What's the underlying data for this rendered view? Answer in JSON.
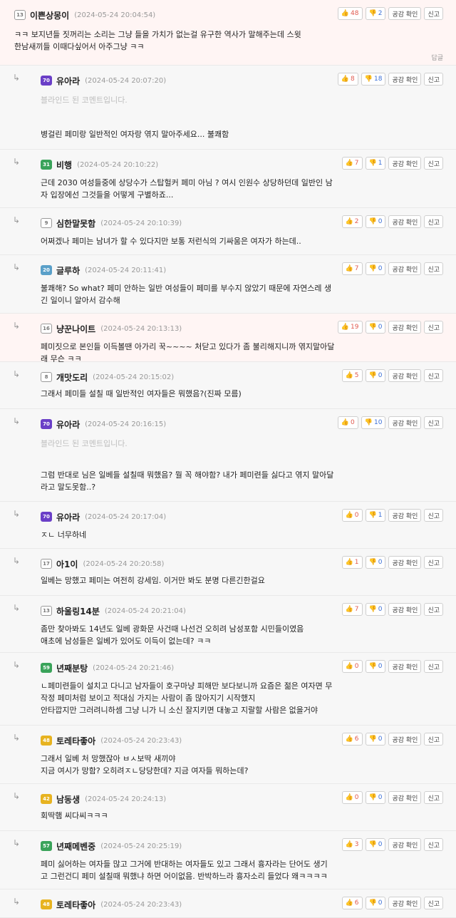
{
  "labels": {
    "empathy": "공감 확인",
    "report": "신고",
    "reply": "답글",
    "blind": "블라인드 된 코멘트입니다."
  },
  "colors": {
    "up": "#e05a4f",
    "down": "#3b6fd6",
    "highlight_bg": "#fff5f4",
    "reply_bg": "#f7f7f7"
  },
  "comments": [
    {
      "level": "13",
      "level_style": "grey",
      "name": "이쁜상몽이",
      "date": "(2024-05-24 20:04:54)",
      "up": "48",
      "down": "2",
      "text": "ㅋㅋ 보지년들 짓꺼리는 소리는 그냥 들을 가치가 없는걸 유구한 역사가 말해주는데 스윗\n한남새끼들 이때다싶어서 아주그냥 ㅋㅋ"
    },
    {
      "level": "70",
      "level_style": "purple",
      "name": "유아라",
      "date": "(2024-05-24 20:07:20)",
      "up": "8",
      "down": "18",
      "text": "병걸린 페미랑 일반적인 여자랑 엮지 말아주세요... 불쾌함"
    },
    {
      "level": "31",
      "level_style": "green",
      "name": "비행",
      "date": "(2024-05-24 20:10:22)",
      "up": "7",
      "down": "1",
      "text": "근데 2030 여성들중에 상당수가 스탑헐커 페미 아님 ? 여시 인원수 상당하던데 일반인 남\n자 입장에선 그것들을 어떻게 구별하죠..."
    },
    {
      "level": "9",
      "level_style": "grey",
      "name": "심한말못함",
      "date": "(2024-05-24 20:10:39)",
      "up": "2",
      "down": "0",
      "text": "어쩌겠나 페미는 남녀가 할 수 있다지만 보통 저런식의 기싸움은 여자가 하는데.."
    },
    {
      "level": "20",
      "level_style": "blue",
      "name": "글루하",
      "date": "(2024-05-24 20:11:41)",
      "up": "7",
      "down": "0",
      "text": "불쾌해? So what? 페미 안하는 일반 여성들이 페미를 부수지 않았기 때문에 자연스레 생\n긴 일이니 알아서 감수해"
    },
    {
      "level": "16",
      "level_style": "grey",
      "name": "냥꾼나이트",
      "date": "(2024-05-24 20:13:13)",
      "up": "19",
      "down": "0",
      "text": "페미짓으로 본인들 이득볼땐 아가리 꾹~~~~ 처닫고 있다가 좀 불리해지니까 엮지말아달\n래 무슨 ㅋㅋ"
    },
    {
      "level": "8",
      "level_style": "grey",
      "name": "개맛도리",
      "date": "(2024-05-24 20:15:02)",
      "up": "5",
      "down": "0",
      "text": "그래서 페미들 설칠 때 일반적인 여자들은 뭐했음?(진짜 모름)"
    },
    {
      "level": "70",
      "level_style": "purple",
      "name": "유아라",
      "date": "(2024-05-24 20:16:15)",
      "up": "0",
      "down": "10",
      "text": "그럼 반대로 님은 일베들 설칠때 뭐했음? 뭘 꼭 해야함? 내가 페미련들 싫다고 엮지 말아달\n라고 말도못함..?"
    },
    {
      "level": "70",
      "level_style": "purple",
      "name": "유아라",
      "date": "(2024-05-24 20:17:04)",
      "up": "0",
      "down": "1",
      "text": "ㅈㄴ 너무하네"
    },
    {
      "level": "17",
      "level_style": "grey",
      "name": "아1이",
      "date": "(2024-05-24 20:20:58)",
      "up": "1",
      "down": "0",
      "text": "일베는 망했고 페미는 여전히 강세임. 이거만 봐도 분명 다른긴한걸요"
    },
    {
      "level": "13",
      "level_style": "grey",
      "name": "하울링14분",
      "date": "(2024-05-24 20:21:04)",
      "up": "7",
      "down": "0",
      "text": "좀만 찾아봐도 14년도 일베 광화문 사건때 나선건 오히려 남성포함 시민들이였음\n애초에 남성들은 일베가 있어도 이득이 없는데? ㅋㅋ"
    },
    {
      "level": "59",
      "level_style": "green",
      "name": "년째분탕",
      "date": "(2024-05-24 20:21:46)",
      "up": "0",
      "down": "0",
      "text": "ㄴ페미련들이 설치고 다니고 남자들이 호구마냥 피해만 보다보니까 요즘은 젊은 여자면 무\n작정 페미처럼 보이고 적대심 가지는 사람이 좀 많아지기 시작했지\n안타깝지만 그러려니하셈 그냥 니가 니 소신 잘지키면 대놓고 지랄할 사람은 없을거야"
    },
    {
      "level": "48",
      "level_style": "yellow",
      "name": "토레타좋아",
      "date": "(2024-05-24 20:23:43)",
      "up": "6",
      "down": "0",
      "text": "그래서 일베 처 망했잖아 ㅂㅅ보딱 새끼야\n지금 여시가 망함? 오히려ㅈㄴ당당한데? 지금 여자들 뭐하는데?"
    },
    {
      "level": "42",
      "level_style": "yellow",
      "name": "남동생",
      "date": "(2024-05-24 20:24:13)",
      "up": "0",
      "down": "0",
      "text": "회딱햄 씨다씨ㅋㅋㅋ"
    },
    {
      "level": "57",
      "level_style": "green",
      "name": "년째메벤중",
      "date": "(2024-05-24 20:25:19)",
      "up": "3",
      "down": "0",
      "text": "페미 싫어하는 여자들 많고 그거에 반대하는 여자들도 있고 그래서 흉자라는 단어도 생기\n고 그런건디 페미 설칠때 뭐했냐 하면 어이없음. 반박하느라 흉자소리 들었다 왜ㅋㅋㅋㅋ"
    },
    {
      "level": "48",
      "level_style": "yellow",
      "name": "토레타좋아",
      "date": "(2024-05-24 20:23:43)",
      "up": "6",
      "down": "0",
      "text": ""
    }
  ]
}
